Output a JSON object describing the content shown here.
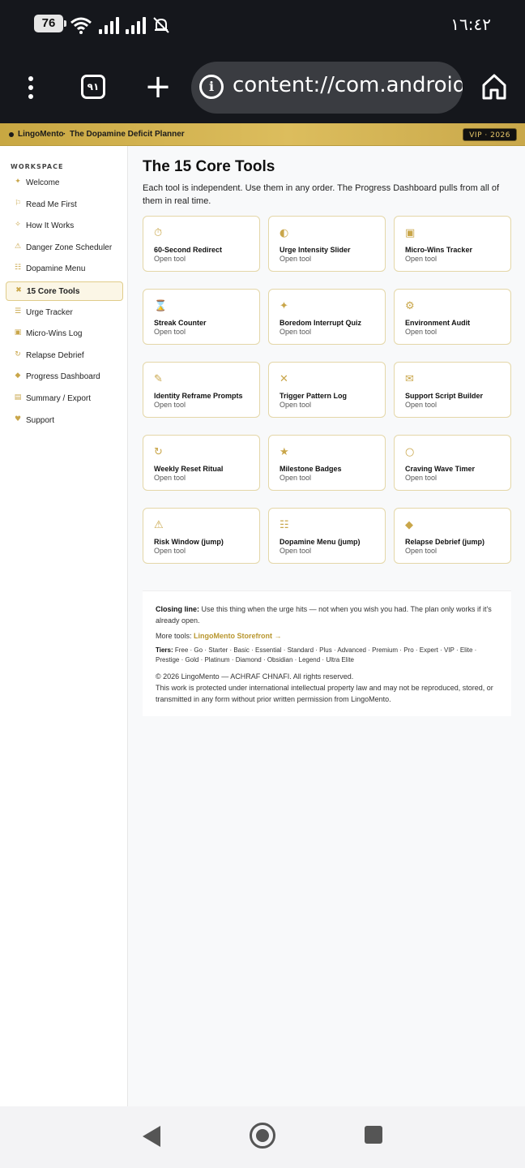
{
  "status_bar": {
    "battery": "76",
    "clock": "١٦:٤٢"
  },
  "browser": {
    "tab_count": "٩١",
    "url": "content://com.android.fi"
  },
  "brand": {
    "name": "LingoMento",
    "separator": "·",
    "subtitle": "The Dopamine Deficit Planner",
    "badge": "VIP · 2026"
  },
  "sidebar": {
    "heading": "WORKSPACE",
    "items": [
      {
        "label": "Welcome",
        "icon": "✦"
      },
      {
        "label": "Read Me First",
        "icon": "⚐"
      },
      {
        "label": "How It Works",
        "icon": "✧"
      },
      {
        "label": "Danger Zone Scheduler",
        "icon": "⚠"
      },
      {
        "label": "Dopamine Menu",
        "icon": "☷"
      },
      {
        "label": "15 Core Tools",
        "icon": "✖"
      },
      {
        "label": "Urge Tracker",
        "icon": "☰"
      },
      {
        "label": "Micro-Wins Log",
        "icon": "▣"
      },
      {
        "label": "Relapse Debrief",
        "icon": "↻"
      },
      {
        "label": "Progress Dashboard",
        "icon": "◆"
      },
      {
        "label": "Summary / Export",
        "icon": "▤"
      },
      {
        "label": "Support",
        "icon": "♥"
      }
    ],
    "active_index": 5
  },
  "main": {
    "title": "The 15 Core Tools",
    "description": "Each tool is independent. Use them in any order. The Progress Dashboard pulls from all of them in real time.",
    "tools": [
      {
        "title": "60-Second Redirect",
        "sub": "Open tool",
        "icon": "⏱"
      },
      {
        "title": "Urge Intensity Slider",
        "sub": "Open tool",
        "icon": "◐"
      },
      {
        "title": "Micro-Wins Tracker",
        "sub": "Open tool",
        "icon": "▣"
      },
      {
        "title": "Streak Counter",
        "sub": "Open tool",
        "icon": "⌛"
      },
      {
        "title": "Boredom Interrupt Quiz",
        "sub": "Open tool",
        "icon": "✦"
      },
      {
        "title": "Environment Audit",
        "sub": "Open tool",
        "icon": "⚙"
      },
      {
        "title": "Identity Reframe Prompts",
        "sub": "Open tool",
        "icon": "✎"
      },
      {
        "title": "Trigger Pattern Log",
        "sub": "Open tool",
        "icon": "✕"
      },
      {
        "title": "Support Script Builder",
        "sub": "Open tool",
        "icon": "✉"
      },
      {
        "title": "Weekly Reset Ritual",
        "sub": "Open tool",
        "icon": "↻"
      },
      {
        "title": "Milestone Badges",
        "sub": "Open tool",
        "icon": "★"
      },
      {
        "title": "Craving Wave Timer",
        "sub": "Open tool",
        "icon": "○"
      },
      {
        "title": "Risk Window (jump)",
        "sub": "Open tool",
        "icon": "⚠"
      },
      {
        "title": "Dopamine Menu (jump)",
        "sub": "Open tool",
        "icon": "☷"
      },
      {
        "title": "Relapse Debrief (jump)",
        "sub": "Open tool",
        "icon": "◆"
      }
    ]
  },
  "footer": {
    "closing_label": "Closing line:",
    "closing_text": "Use this thing when the urge hits — not when you wish you had. The plan only works if it's already open.",
    "more_label": "More tools:",
    "more_link": "LingoMento Storefront →",
    "tiers_label": "Tiers:",
    "tiers_text": "Free · Go · Starter · Basic · Essential · Standard · Plus · Advanced · Premium · Pro · Expert · VIP · Elite · Prestige · Gold · Platinum · Diamond · Obsidian · Legend · Ultra Elite",
    "copyright": "© 2026 LingoMento — ACHRAF CHNAFI. All rights reserved.",
    "legal": "This work is protected under international intellectual property law and may not be reproduced, stored, or transmitted in any form without prior written permission from LingoMento."
  },
  "colors": {
    "accent_gold": "#c9a64a",
    "chrome_bg": "#15171c"
  }
}
